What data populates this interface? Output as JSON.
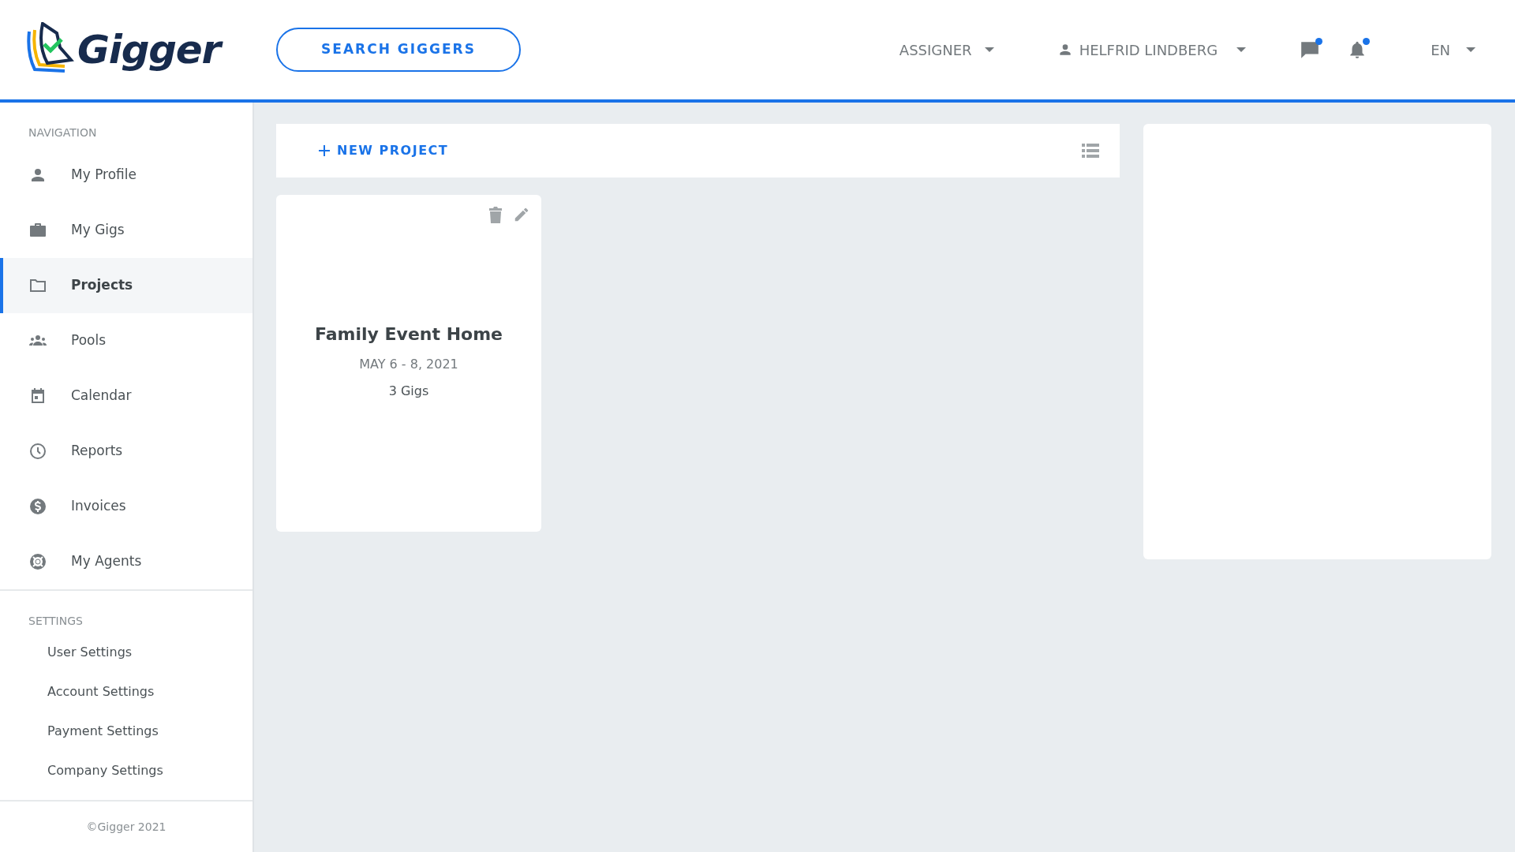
{
  "header": {
    "logo_text": "Gigger",
    "search_button": "SEARCH GIGGERS",
    "role_menu": "ASSIGNER",
    "user_menu": "HELFRID LINDBERG",
    "notifications": [
      {
        "kind": "messages",
        "unread": true
      },
      {
        "kind": "bell",
        "unread": true
      }
    ],
    "language": "EN"
  },
  "sidebar": {
    "navigation_title": "NAVIGATION",
    "items": [
      {
        "label": "My Profile",
        "selected": false
      },
      {
        "label": "My Gigs",
        "selected": false
      },
      {
        "label": "Projects",
        "selected": true
      },
      {
        "label": "Pools",
        "selected": false
      },
      {
        "label": "Calendar",
        "selected": false
      },
      {
        "label": "Reports",
        "selected": false
      },
      {
        "label": "Invoices",
        "selected": false
      },
      {
        "label": "My Agents",
        "selected": false
      }
    ],
    "settings_title": "SETTINGS",
    "settings_items": [
      "User Settings",
      "Account Settings",
      "Payment Settings",
      "Company Settings"
    ],
    "footer": "©Gigger 2021"
  },
  "toolbar": {
    "new_project": "NEW PROJECT"
  },
  "projects": [
    {
      "title": "Family Event Home",
      "dates": "MAY 6 - 8, 2021",
      "gigs": "3 Gigs"
    }
  ]
}
